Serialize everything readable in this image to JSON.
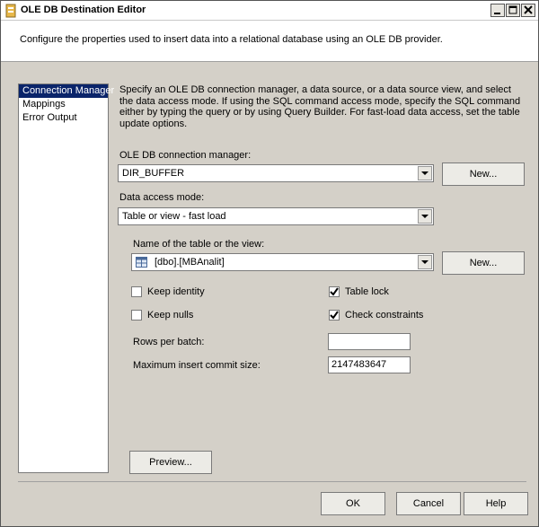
{
  "window": {
    "title": "OLE DB Destination Editor",
    "description": "Configure the properties used to insert data into a relational database using an OLE DB provider."
  },
  "nav": {
    "items": [
      "Connection Manager",
      "Mappings",
      "Error Output"
    ],
    "selected": "Connection Manager"
  },
  "intro": "Specify an OLE DB connection manager, a data source, or a data source view, and select the data access mode. If using the SQL command access mode, specify the SQL command either by typing the query or by using Query Builder. For fast-load data access, set the table update options.",
  "connection": {
    "label": "OLE DB connection manager:",
    "value": "DIR_BUFFER",
    "new_button": "New..."
  },
  "access_mode": {
    "label": "Data access mode:",
    "value": "Table or view - fast load"
  },
  "table": {
    "label": "Name of the table or the view:",
    "value": "[dbo].[MBAnalit]",
    "new_button": "New..."
  },
  "options": {
    "keep_identity": {
      "label": "Keep identity",
      "checked": false
    },
    "keep_nulls": {
      "label": "Keep nulls",
      "checked": false
    },
    "table_lock": {
      "label": "Table lock",
      "checked": true
    },
    "check_constraints": {
      "label": "Check constraints",
      "checked": true
    }
  },
  "rows_per_batch": {
    "label": "Rows per batch:",
    "value": ""
  },
  "max_commit": {
    "label": "Maximum insert commit size:",
    "value": "2147483647"
  },
  "buttons": {
    "preview": "Preview...",
    "ok": "OK",
    "cancel": "Cancel",
    "help": "Help"
  }
}
